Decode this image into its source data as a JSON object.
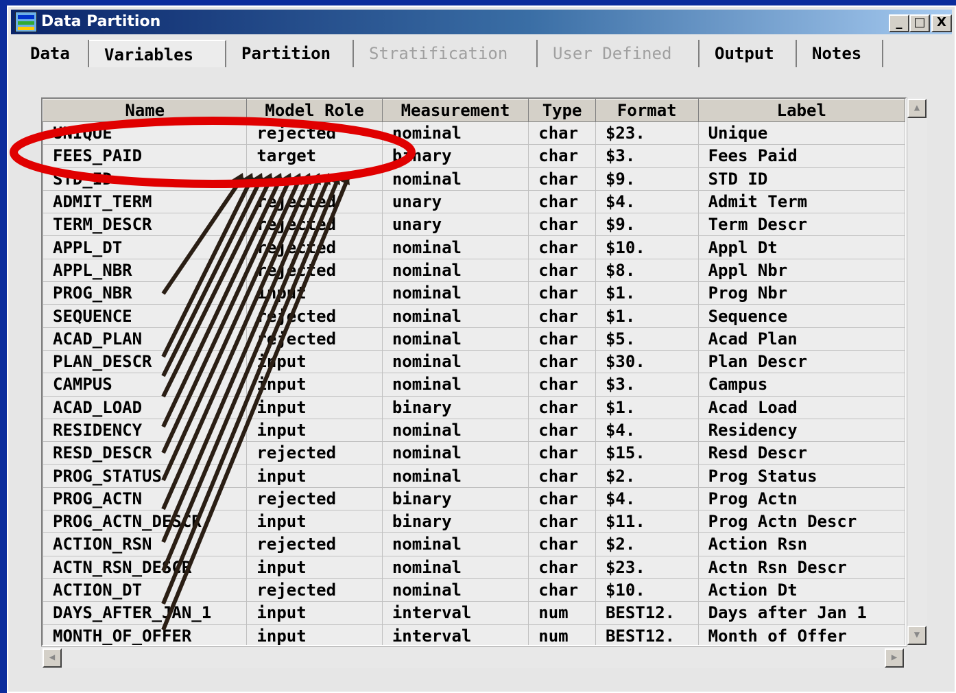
{
  "window": {
    "title": "Data Partition",
    "buttons": [
      "_",
      "□",
      "X"
    ]
  },
  "tabs": [
    {
      "label": "Data",
      "enabled": true
    },
    {
      "label": "Variables",
      "enabled": true,
      "active": true
    },
    {
      "label": "Partition",
      "enabled": true
    },
    {
      "label": "Stratification",
      "enabled": false
    },
    {
      "label": "User Defined",
      "enabled": false
    },
    {
      "label": "Output",
      "enabled": true
    },
    {
      "label": "Notes",
      "enabled": true
    }
  ],
  "table": {
    "columns": [
      "Name",
      "Model Role",
      "Measurement",
      "Type",
      "Format",
      "Label"
    ],
    "rows": [
      [
        "UNIQUE",
        "rejected",
        "nominal",
        "char",
        "$23.",
        "Unique"
      ],
      [
        "FEES_PAID",
        "target",
        "binary",
        "char",
        "$3.",
        "Fees Paid"
      ],
      [
        "STD_ID",
        "",
        "nominal",
        "char",
        "$9.",
        "STD ID"
      ],
      [
        "ADMIT_TERM",
        "rejected",
        "unary",
        "char",
        "$4.",
        "Admit Term"
      ],
      [
        "TERM_DESCR",
        "rejected",
        "unary",
        "char",
        "$9.",
        "Term Descr"
      ],
      [
        "APPL_DT",
        "rejected",
        "nominal",
        "char",
        "$10.",
        "Appl Dt"
      ],
      [
        "APPL_NBR",
        "rejected",
        "nominal",
        "char",
        "$8.",
        "Appl Nbr"
      ],
      [
        "PROG_NBR",
        "input",
        "nominal",
        "char",
        "$1.",
        "Prog Nbr"
      ],
      [
        "SEQUENCE",
        "rejected",
        "nominal",
        "char",
        "$1.",
        "Sequence"
      ],
      [
        "ACAD_PLAN",
        "rejected",
        "nominal",
        "char",
        "$5.",
        "Acad Plan"
      ],
      [
        "PLAN_DESCR",
        "input",
        "nominal",
        "char",
        "$30.",
        "Plan Descr"
      ],
      [
        "CAMPUS",
        "input",
        "nominal",
        "char",
        "$3.",
        "Campus"
      ],
      [
        "ACAD_LOAD",
        "input",
        "binary",
        "char",
        "$1.",
        "Acad Load"
      ],
      [
        "RESIDENCY",
        "input",
        "nominal",
        "char",
        "$4.",
        "Residency"
      ],
      [
        "RESD_DESCR",
        "rejected",
        "nominal",
        "char",
        "$15.",
        "Resd Descr"
      ],
      [
        "PROG_STATUS",
        "input",
        "nominal",
        "char",
        "$2.",
        "Prog Status"
      ],
      [
        "PROG_ACTN",
        "rejected",
        "binary",
        "char",
        "$4.",
        "Prog Actn"
      ],
      [
        "PROG_ACTN_DESCR",
        "input",
        "binary",
        "char",
        "$11.",
        "Prog Actn Descr"
      ],
      [
        "ACTION_RSN",
        "rejected",
        "nominal",
        "char",
        "$2.",
        "Action Rsn"
      ],
      [
        "ACTN_RSN_DESCR",
        "input",
        "nominal",
        "char",
        "$23.",
        "Actn Rsn Descr"
      ],
      [
        "ACTION_DT",
        "rejected",
        "nominal",
        "char",
        "$10.",
        "Action Dt"
      ],
      [
        "DAYS_AFTER_JAN_1",
        "input",
        "interval",
        "num",
        "BEST12.",
        "Days after Jan 1"
      ],
      [
        "MONTH_OF_OFFER",
        "input",
        "interval",
        "num",
        "BEST12.",
        "Month of Offer"
      ]
    ]
  },
  "annotation": {
    "highlight_color": "#e00000",
    "arrow_color": "#2a1e14"
  }
}
